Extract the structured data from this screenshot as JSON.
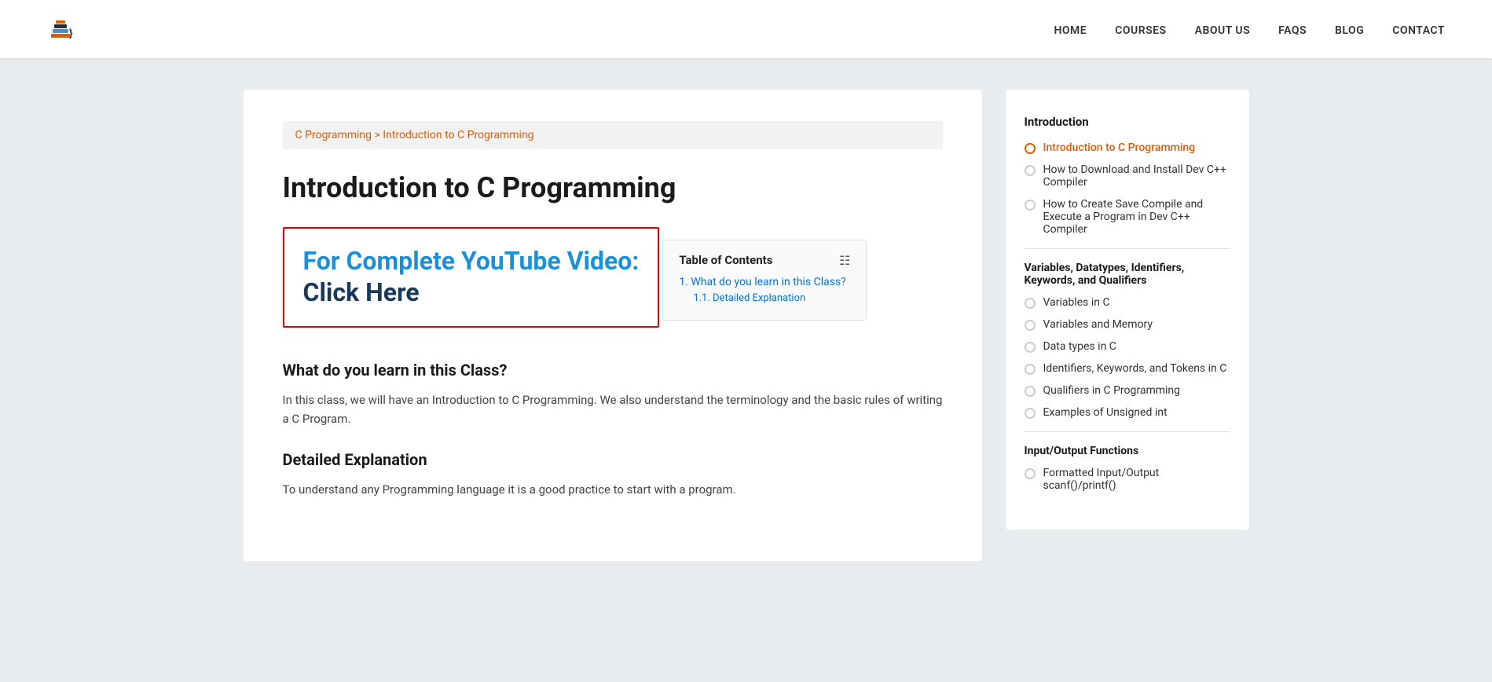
{
  "header": {
    "logo_alt": "LearnCoding Logo",
    "nav": [
      {
        "label": "HOME",
        "href": "#"
      },
      {
        "label": "COURSES",
        "href": "#"
      },
      {
        "label": "ABOUT US",
        "href": "#"
      },
      {
        "label": "FAQS",
        "href": "#"
      },
      {
        "label": "BLOG",
        "href": "#"
      },
      {
        "label": "CONTACT",
        "href": "#"
      }
    ]
  },
  "breadcrumb": {
    "part1": "C Programming",
    "separator": " > ",
    "part2": "Introduction to C Programming"
  },
  "main": {
    "title": "Introduction to C Programming",
    "youtube_line1": "For Complete YouTube Video:",
    "youtube_line2": "Click Here",
    "toc": {
      "title": "Table of Contents",
      "items": [
        {
          "number": "1.",
          "label": "What do you learn in this Class?",
          "sub": [
            {
              "number": "1.1.",
              "label": "Detailed Explanation"
            }
          ]
        }
      ]
    },
    "section1_heading": "What do you learn in this Class?",
    "section1_body": "In this class, we will have an Introduction to C Programming. We also understand the terminology and the basic rules of writing a C Program.",
    "section2_heading": "Detailed Explanation",
    "section2_body": "To understand any Programming language it is a good practice to start with a program."
  },
  "sidebar": {
    "intro_title": "Introduction",
    "intro_items": [
      {
        "label": "Introduction to C Programming",
        "active": true
      },
      {
        "label": "How to Download and Install Dev C++ Compiler",
        "active": false
      },
      {
        "label": "How to Create Save Compile and Execute a Program in Dev C++ Compiler",
        "active": false
      }
    ],
    "variables_title": "Variables, Datatypes, Identifiers, Keywords, and Qualifiers",
    "variables_items": [
      {
        "label": "Variables in C"
      },
      {
        "label": "Variables and Memory"
      },
      {
        "label": "Data types in C"
      },
      {
        "label": "Identifiers, Keywords, and Tokens in C"
      },
      {
        "label": "Qualifiers in C Programming"
      },
      {
        "label": "Examples of Unsigned int"
      }
    ],
    "io_title": "Input/Output Functions",
    "io_items": [
      {
        "label": "Formatted Input/Output scanf()/printf()"
      }
    ]
  }
}
